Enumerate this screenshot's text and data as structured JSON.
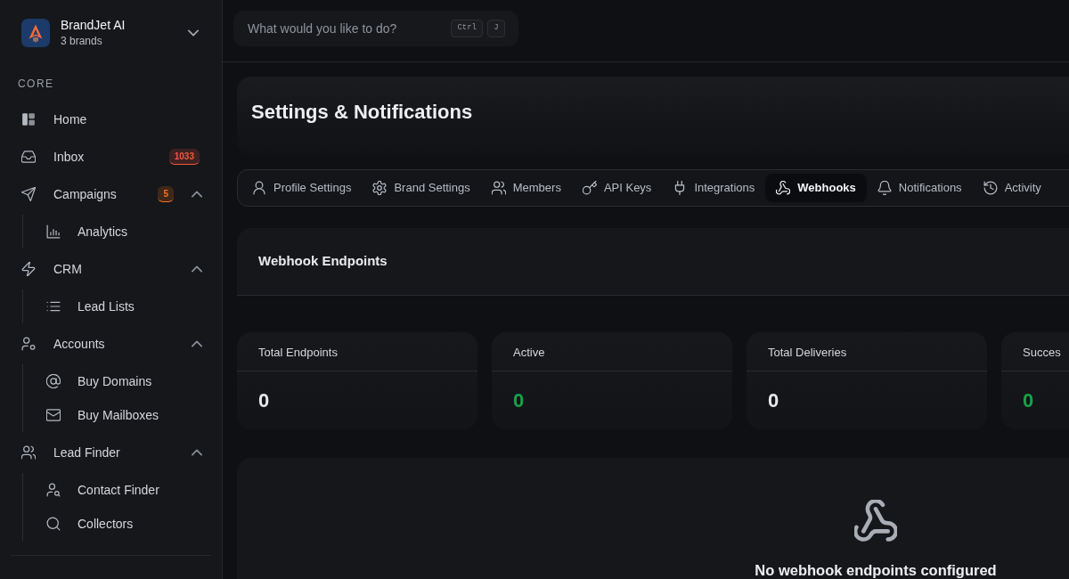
{
  "sidebar": {
    "brand": {
      "name": "BrandJet AI",
      "subtitle": "3 brands"
    },
    "section_label": "CORE",
    "items": [
      {
        "label": "Home"
      },
      {
        "label": "Inbox",
        "badge": {
          "text": "1033",
          "color": "#ef5a3c"
        }
      },
      {
        "label": "Campaigns",
        "badge": {
          "text": "5",
          "color": "#f97316"
        },
        "expanded": true,
        "children": [
          {
            "label": "Analytics"
          }
        ]
      },
      {
        "label": "CRM",
        "expanded": true,
        "children": [
          {
            "label": "Lead Lists"
          }
        ]
      },
      {
        "label": "Accounts",
        "expanded": true,
        "children": [
          {
            "label": "Buy Domains"
          },
          {
            "label": "Buy Mailboxes"
          }
        ]
      },
      {
        "label": "Lead Finder",
        "expanded": true,
        "children": [
          {
            "label": "Contact Finder"
          },
          {
            "label": "Collectors"
          }
        ]
      }
    ]
  },
  "search": {
    "placeholder": "What would you like to do?",
    "shortcut": [
      "Ctrl",
      "J"
    ]
  },
  "page_title": "Settings & Notifications",
  "tabs": [
    {
      "label": "Profile Settings",
      "selected": false
    },
    {
      "label": "Brand Settings",
      "selected": false
    },
    {
      "label": "Members",
      "selected": false
    },
    {
      "label": "API Keys",
      "selected": false
    },
    {
      "label": "Integrations",
      "selected": false
    },
    {
      "label": "Webhooks",
      "selected": true
    },
    {
      "label": "Notifications",
      "selected": false
    },
    {
      "label": "Activity",
      "selected": false
    }
  ],
  "webhooks": {
    "title": "Webhook Endpoints",
    "stats": [
      {
        "label": "Total Endpoints",
        "value": "0",
        "color": "#e5e7eb"
      },
      {
        "label": "Active",
        "value": "0",
        "color": "#16a34a"
      },
      {
        "label": "Total Deliveries",
        "value": "0",
        "color": "#e5e7eb"
      },
      {
        "label": "Succes",
        "value": "0",
        "color": "#16a34a"
      }
    ],
    "empty_state": {
      "message": "No webhook endpoints configured"
    }
  }
}
